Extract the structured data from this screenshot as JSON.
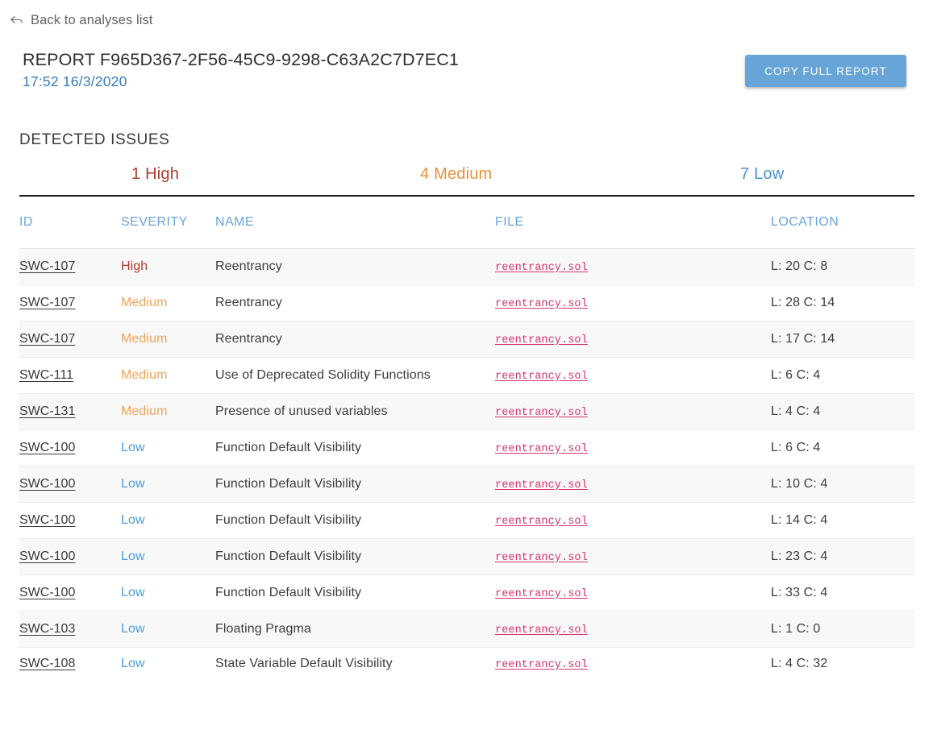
{
  "nav": {
    "back_label": "Back to analyses list",
    "back_icon": "back-arrow-icon"
  },
  "header": {
    "title": "REPORT F965D367-2F56-45C9-9298-C63A2C7D7EC1",
    "timestamp": "17:52 16/3/2020",
    "copy_button_label": "COPY FULL REPORT"
  },
  "section": {
    "title": "DETECTED ISSUES"
  },
  "summary": [
    {
      "count": "1",
      "label": "High",
      "text": "1 High",
      "color": "#b03a2e"
    },
    {
      "count": "4",
      "label": "Medium",
      "text": "4 Medium",
      "color": "#e8913c"
    },
    {
      "count": "7",
      "label": "Low",
      "text": "7 Low",
      "color": "#4a90d9"
    }
  ],
  "table": {
    "columns": [
      "ID",
      "SEVERITY",
      "NAME",
      "FILE",
      "LOCATION"
    ],
    "rows": [
      {
        "id": "SWC-107",
        "severity": "High",
        "severity_class": "sev-high",
        "name": "Reentrancy",
        "file": "reentrancy.sol",
        "location": "L: 20 C: 8"
      },
      {
        "id": "SWC-107",
        "severity": "Medium",
        "severity_class": "sev-medium",
        "name": "Reentrancy",
        "file": "reentrancy.sol",
        "location": "L: 28 C: 14"
      },
      {
        "id": "SWC-107",
        "severity": "Medium",
        "severity_class": "sev-medium",
        "name": "Reentrancy",
        "file": "reentrancy.sol",
        "location": "L: 17 C: 14"
      },
      {
        "id": "SWC-111",
        "severity": "Medium",
        "severity_class": "sev-medium",
        "name": "Use of Deprecated Solidity Functions",
        "file": "reentrancy.sol",
        "location": "L: 6 C: 4"
      },
      {
        "id": "SWC-131",
        "severity": "Medium",
        "severity_class": "sev-medium",
        "name": "Presence of unused variables",
        "file": "reentrancy.sol",
        "location": "L: 4 C: 4"
      },
      {
        "id": "SWC-100",
        "severity": "Low",
        "severity_class": "sev-low",
        "name": "Function Default Visibility",
        "file": "reentrancy.sol",
        "location": "L: 6 C: 4"
      },
      {
        "id": "SWC-100",
        "severity": "Low",
        "severity_class": "sev-low",
        "name": "Function Default Visibility",
        "file": "reentrancy.sol",
        "location": "L: 10 C: 4"
      },
      {
        "id": "SWC-100",
        "severity": "Low",
        "severity_class": "sev-low",
        "name": "Function Default Visibility",
        "file": "reentrancy.sol",
        "location": "L: 14 C: 4"
      },
      {
        "id": "SWC-100",
        "severity": "Low",
        "severity_class": "sev-low",
        "name": "Function Default Visibility",
        "file": "reentrancy.sol",
        "location": "L: 23 C: 4"
      },
      {
        "id": "SWC-100",
        "severity": "Low",
        "severity_class": "sev-low",
        "name": "Function Default Visibility",
        "file": "reentrancy.sol",
        "location": "L: 33 C: 4"
      },
      {
        "id": "SWC-103",
        "severity": "Low",
        "severity_class": "sev-low",
        "name": "Floating Pragma",
        "file": "reentrancy.sol",
        "location": "L: 1 C: 0"
      },
      {
        "id": "SWC-108",
        "severity": "Low",
        "severity_class": "sev-low",
        "name": "State Variable Default Visibility",
        "file": "reentrancy.sol",
        "location": "L: 4 C: 32"
      }
    ]
  }
}
